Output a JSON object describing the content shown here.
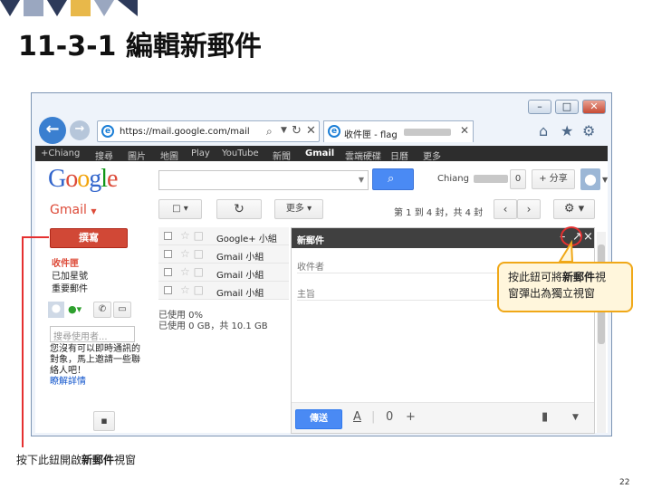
{
  "slide": {
    "title": "11-3-1 編輯新郵件",
    "page_number": "22",
    "callout_line1_pre": "按此鈕可將",
    "callout_line1_bold": "新郵件",
    "callout_line1_post": "視",
    "callout_line2": "窗彈出為獨立視窗",
    "note_pre": "按下此鈕開啟",
    "note_bold": "新郵件",
    "note_post": "視窗",
    "colors": {
      "deco_dark": "#2d3a5a",
      "deco_mid": "#9aa7c0",
      "deco_gold": "#e8b84a",
      "highlight": "#e53030"
    }
  },
  "browser": {
    "address": "https://mail.google.com/mail",
    "tab_label": "收件匣 - flag",
    "window_controls": [
      "minimize-icon",
      "maximize-icon",
      "close-icon"
    ]
  },
  "google_bar": {
    "items": [
      "+Chiang",
      "搜尋",
      "圖片",
      "地圖",
      "Play",
      "YouTube",
      "新聞",
      "Gmail",
      "雲端硬碟",
      "日曆",
      "更多"
    ],
    "active": "Gmail"
  },
  "gmail": {
    "logo_letters": [
      "G",
      "o",
      "o",
      "g",
      "l",
      "e"
    ],
    "logo_colors": [
      "#3366cc",
      "#dd4b39",
      "#f2a40c",
      "#3366cc",
      "#109618",
      "#dd4b39"
    ],
    "user_name": "Chiang",
    "notification_count": "0",
    "share_label": "+ 分享",
    "label": "Gmail",
    "compose_label": "撰寫",
    "folders": [
      "收件匣",
      "已加星號",
      "重要郵件"
    ],
    "more_label": "更多",
    "pagination": "第 1 到 4 封，共 4 封",
    "chat_search_placeholder": "搜尋使用者...",
    "chat_message": "您沒有可以即時通訊的對象，馬上邀請一些聯絡人吧！",
    "chat_link": "瞭解詳情",
    "messages": [
      {
        "sender": "Google+ 小組"
      },
      {
        "sender": "Gmail 小組"
      },
      {
        "sender": "Gmail 小組"
      },
      {
        "sender": "Gmail 小組"
      }
    ],
    "storage_line1": "已使用 0%",
    "storage_line2": "已使用 0 GB，共 10.1 GB"
  },
  "compose_window": {
    "title": "新郵件",
    "to_placeholder": "收件者",
    "subject_placeholder": "主旨",
    "send_label": "傳送"
  }
}
